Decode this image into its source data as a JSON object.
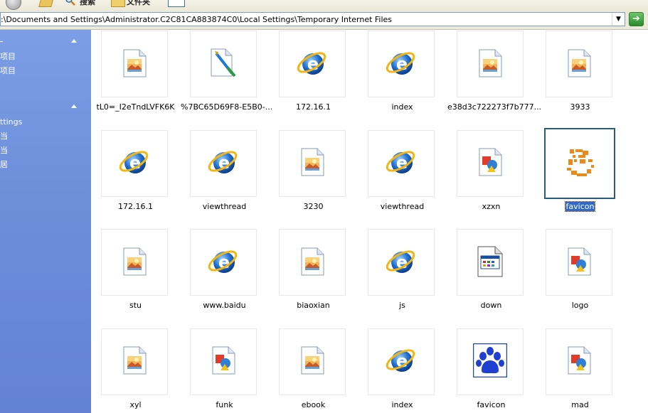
{
  "toolbar": {
    "search_label": "搜索",
    "folders_label": "文件夹"
  },
  "address": {
    "path": ":\\Documents and Settings\\Administrator.C2C81CA883874C0\\Local Settings\\Temporary Internet Files",
    "dropdown_glyph": "▼",
    "go_glyph": "➔"
  },
  "taskpane": {
    "section1": {
      "items": [
        "项目",
        "项目"
      ]
    },
    "section2": {
      "items": [
        "ttings",
        "当",
        "当",
        "居"
      ]
    }
  },
  "files": [
    {
      "name": "tL0=_I2eTndLVFK6K",
      "icon": "image-icon"
    },
    {
      "name": "%7BC65D69F8-E5B0-...",
      "icon": "paint-brush-icon"
    },
    {
      "name": "172.16.1",
      "icon": "ie-icon"
    },
    {
      "name": "index",
      "icon": "ie-icon"
    },
    {
      "name": "e38d3c722273f7b777...",
      "icon": "image-icon"
    },
    {
      "name": "3933",
      "icon": "image-icon"
    },
    {
      "name": "172.16.1",
      "icon": "ie-icon"
    },
    {
      "name": "viewthread",
      "icon": "ie-icon"
    },
    {
      "name": "3230",
      "icon": "image-icon"
    },
    {
      "name": "viewthread",
      "icon": "ie-icon"
    },
    {
      "name": "xzxn",
      "icon": "shapes-icon"
    },
    {
      "name": "favicon",
      "icon": "smiley-favicon-icon",
      "selected": true
    },
    {
      "name": "stu",
      "icon": "image-icon"
    },
    {
      "name": "www.baidu",
      "icon": "ie-icon"
    },
    {
      "name": "biaoxian",
      "icon": "image-icon"
    },
    {
      "name": "js",
      "icon": "ie-icon"
    },
    {
      "name": "down",
      "icon": "window-icon"
    },
    {
      "name": "logo",
      "icon": "shapes-icon"
    },
    {
      "name": "xyl",
      "icon": "image-icon"
    },
    {
      "name": "funk",
      "icon": "shapes-icon"
    },
    {
      "name": "ebook",
      "icon": "image-icon"
    },
    {
      "name": "index",
      "icon": "ie-icon"
    },
    {
      "name": "favicon",
      "icon": "paw-favicon-icon"
    },
    {
      "name": "mad",
      "icon": "shapes-icon"
    }
  ],
  "colors": {
    "taskpane": "#6f8fda",
    "selection": "#316ac5",
    "selected_border": "#2c5a7a",
    "ie_blue": "#1f6fd0",
    "favicon_orange": "#e98a1a"
  }
}
